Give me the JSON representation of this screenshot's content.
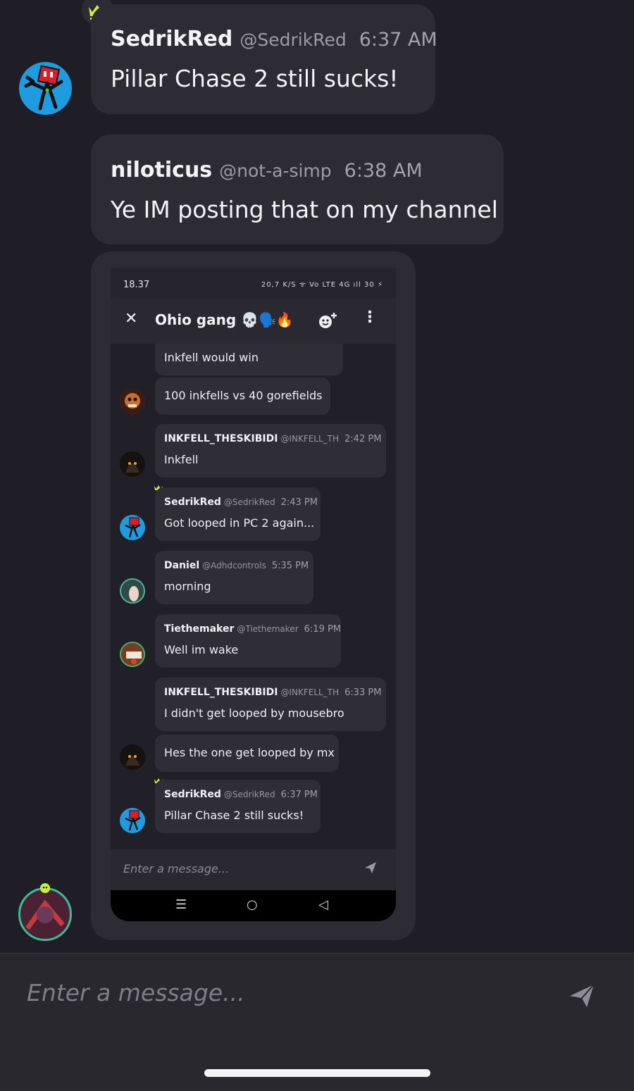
{
  "messages": [
    {
      "user": "SedrikRed",
      "handle": "@SedrikRed",
      "time": "6:37 AM",
      "text": "Pillar Chase 2 still sucks!"
    },
    {
      "user": "niloticus",
      "handle": "@not-a-simp",
      "time": "6:38 AM",
      "text": "Ye IM posting that on my channel"
    }
  ],
  "embedded": {
    "status_time": "18.37",
    "status_icons": "20,7 K/S ᯤ Vo LTE 4G ıll 30 ⚡",
    "chat_title": "Ohio gang 💀🗣️🔥",
    "messages": [
      {
        "user": "",
        "handle": "",
        "time": "",
        "text": "Inkfell would win"
      },
      {
        "user": "",
        "handle": "",
        "time": "",
        "text": "100 inkfells vs 40 gorefields"
      },
      {
        "user": "INKFELL_THESKIBIDI",
        "handle": "@INKFELL_TH",
        "time": "2:42 PM",
        "text": "Inkfell"
      },
      {
        "user": "SedrikRed",
        "handle": "@SedrikRed",
        "time": "2:43 PM",
        "text": "Got looped in PC 2 again..."
      },
      {
        "user": "Daniel",
        "handle": "@Adhdcontrols",
        "time": "5:35 PM",
        "text": "morning"
      },
      {
        "user": "Tiethemaker",
        "handle": "@Tiethemaker",
        "time": "6:19 PM",
        "text": "Well im wake"
      },
      {
        "user": "INKFELL_THESKIBIDI",
        "handle": "@INKFELL_TH",
        "time": "6:33 PM",
        "text": "I didn't get looped by mousebro"
      },
      {
        "user": "",
        "handle": "",
        "time": "",
        "text": "Hes the one get looped by mx"
      },
      {
        "user": "SedrikRed",
        "handle": "@SedrikRed",
        "time": "6:37 PM",
        "text": "Pillar Chase 2 still sucks!"
      }
    ],
    "input_placeholder": "Enter a message..."
  },
  "composer": {
    "placeholder": "Enter a message..."
  },
  "icons": {
    "crown": "crown-icon",
    "send": "send-icon",
    "close": "close-icon",
    "add_member": "add-member-icon",
    "more": "more-icon"
  },
  "colors": {
    "background": "#1f1e26",
    "card": "#2d2c35",
    "crown": "#c8f23a",
    "avatar_blue": "#1f9be0"
  }
}
